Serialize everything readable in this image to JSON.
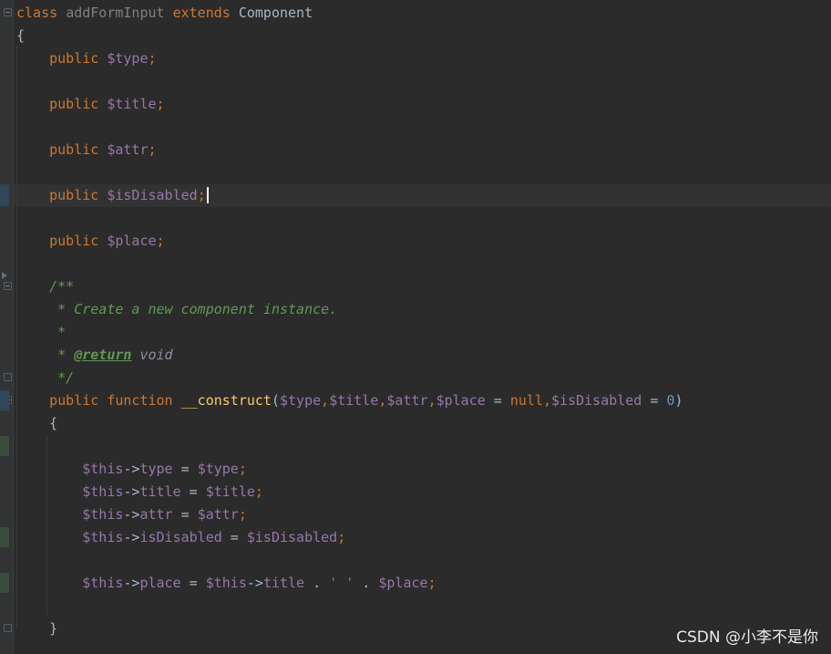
{
  "colors": {
    "background": "#2b2b2b",
    "keyword": "#cc7832",
    "variable": "#9876aa",
    "function": "#ffc66d",
    "number": "#6897bb",
    "comment": "#629755",
    "default": "#a9b7c6"
  },
  "code": {
    "class_keyword": "class",
    "class_name": "addFormInput",
    "extends_keyword": "extends",
    "parent_class": "Component",
    "open_brace": "{",
    "public_kw": "public",
    "prop_type": "$type",
    "prop_title": "$title",
    "prop_attr": "$attr",
    "prop_isDisabled": "$isDisabled",
    "prop_place": "$place",
    "semicolon": ";",
    "doc_open": "/**",
    "doc_line1": " * Create a new component instance.",
    "doc_star": " *",
    "doc_return_prefix": " * ",
    "doc_return_tag": "@return",
    "doc_return_type": "void",
    "doc_close": " */",
    "function_kw": "function",
    "function_name": "__construct",
    "params": {
      "open": "(",
      "p_type": "$type",
      "comma": ",",
      "p_title": "$title",
      "p_attr": "$attr",
      "p_place": "$place",
      "eq": " = ",
      "null_kw": "null",
      "p_isDisabled": "$isDisabled",
      "zero": "0",
      "close": ")"
    },
    "this_var": "$this",
    "arrow": "->",
    "field_type": "type",
    "field_title": "title",
    "field_attr": "attr",
    "field_isDisabled": "isDisabled",
    "field_place": "place",
    "assign": " = ",
    "concat": " . ",
    "quoted_space": "' '",
    "close_brace": "}"
  },
  "watermark": "CSDN @小李不是你"
}
